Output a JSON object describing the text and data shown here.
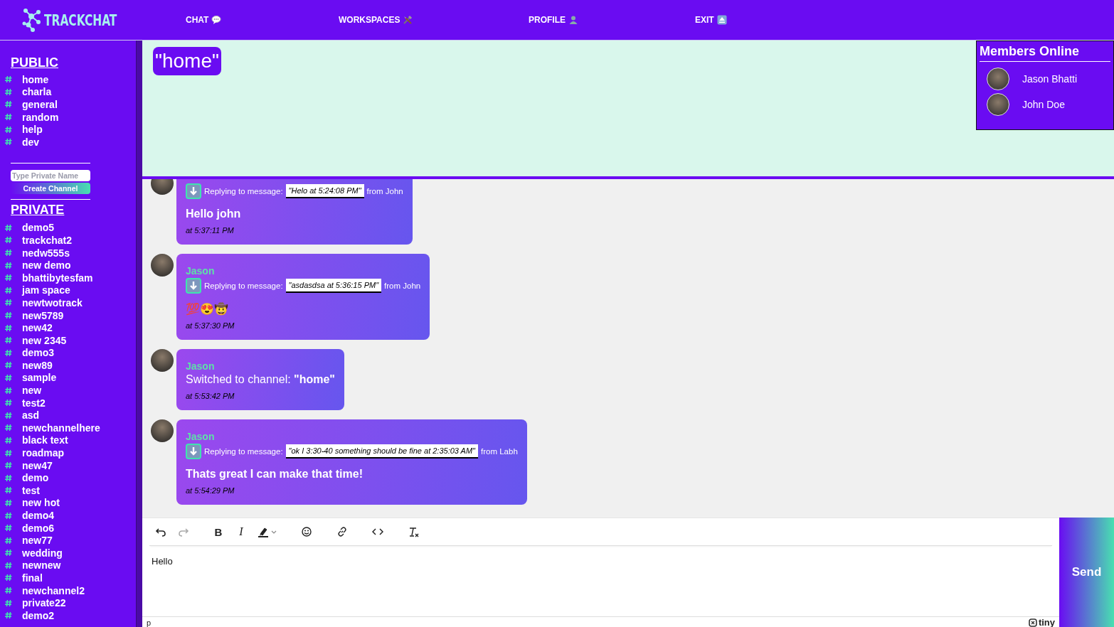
{
  "nav": {
    "logo": "TRACKCHAT",
    "links": [
      {
        "label": "CHAT",
        "kind": "speech"
      },
      {
        "label": "WORKSPACES",
        "kind": "tools"
      },
      {
        "label": "PROFILE",
        "kind": "person"
      },
      {
        "label": "EXIT",
        "kind": "eject"
      }
    ]
  },
  "sidebar": {
    "public_heading": "PUBLIC",
    "public_channels": [
      "home",
      "charla",
      "general",
      "random",
      "help",
      "dev"
    ],
    "private_name_field": {
      "placeholder": "Type Private Name"
    },
    "create_button": "Create Channel",
    "private_heading": "PRIVATE",
    "private_channels": [
      "demo5",
      "trackchat2",
      "nedw555s",
      "new demo",
      "bhattibytesfam",
      "jam space",
      "newtwotrack",
      "new5789",
      "new42",
      "new 2345",
      "demo3",
      "new89",
      "sample",
      "new",
      "test2",
      "asd",
      "newchannelhere",
      "black text",
      "roadmap",
      "new47",
      "demo",
      "test",
      "new hot",
      "demo4",
      "demo6",
      "new77",
      "wedding",
      "newnew",
      "final",
      "newchannel2",
      "private22",
      "demo2"
    ]
  },
  "channel_title": "\"home\"",
  "members_online": {
    "title": "Members Online",
    "members": [
      "Jason Bhatti",
      "John Doe"
    ]
  },
  "messages": [
    {
      "kind": "reply",
      "reply_label": "Replying to message:",
      "quote": "\"Helo at 5:24:08 PM\"",
      "from": "from John",
      "text": "Hello john",
      "time": "at 5:37:11 PM"
    },
    {
      "kind": "reply",
      "sender": "Jason",
      "reply_label": "Replying to message:",
      "quote": "\"asdasdsa at 5:36:15 PM\"",
      "from": "from John",
      "text": "💯😍🤠",
      "time": "at 5:37:30 PM"
    },
    {
      "kind": "event",
      "sender": "Jason",
      "text": "Switched to channel: **\"home\"**",
      "time": "at 5:53:42 PM"
    },
    {
      "kind": "reply",
      "sender": "Jason",
      "reply_label": "Replying to message:",
      "quote": "\"ok I 3:30-40 something should be fine at 2:35:03 AM\"",
      "from": "from Labh",
      "text": "Thats great I can make that time!",
      "time": "at 5:54:29 PM"
    }
  ],
  "editor": {
    "toolbar": [
      {
        "kind": "undo",
        "disabled": false
      },
      {
        "kind": "redo",
        "disabled": true
      },
      {
        "kind": "bold",
        "label": "B",
        "disabled": false
      },
      {
        "kind": "italic",
        "label": "I",
        "disabled": false
      },
      {
        "kind": "highlight",
        "disabled": false
      },
      {
        "kind": "emoji",
        "disabled": false
      },
      {
        "kind": "link",
        "disabled": false
      },
      {
        "kind": "code",
        "disabled": false
      },
      {
        "kind": "clear",
        "disabled": false
      }
    ],
    "value": "Hello",
    "status_path": "p",
    "brand": "tiny",
    "send_button": "Send"
  }
}
